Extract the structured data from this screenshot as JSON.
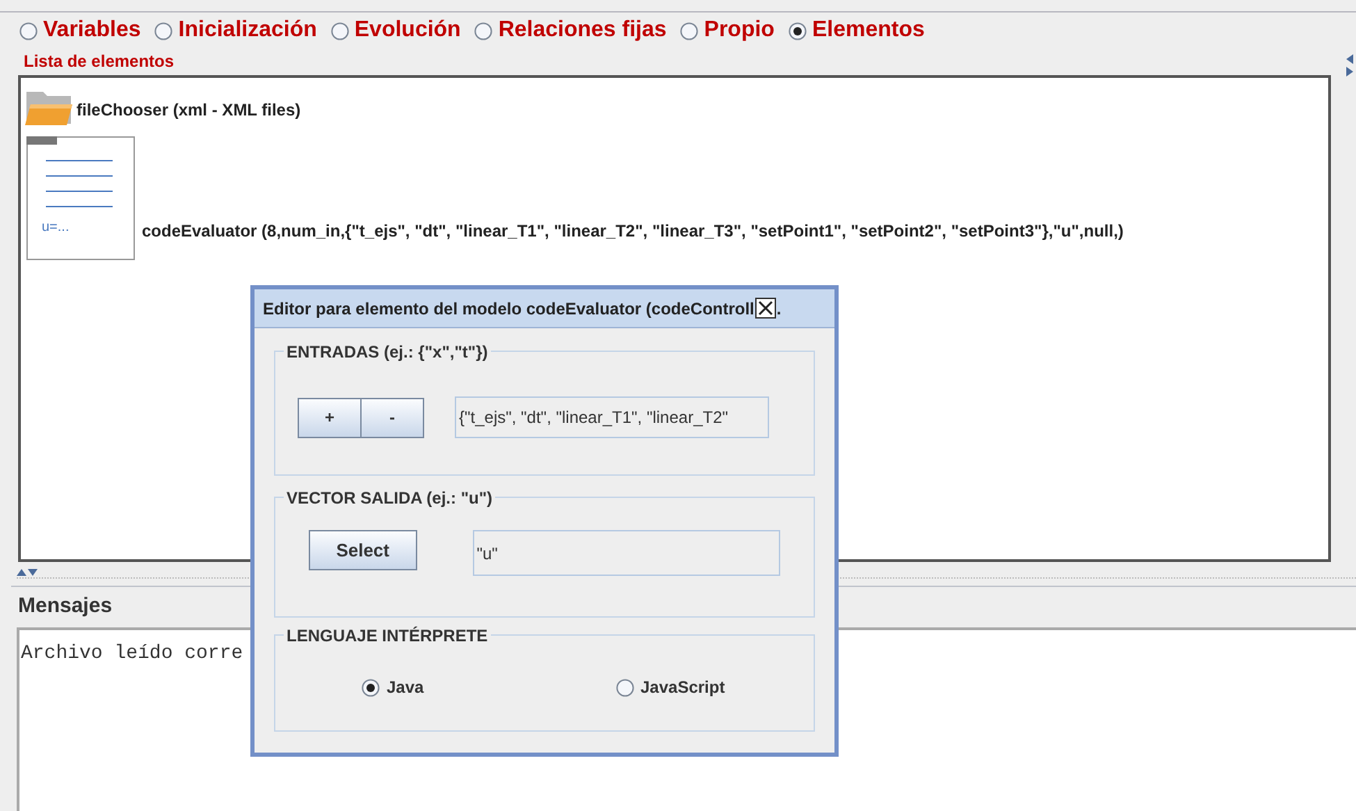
{
  "tabs": [
    {
      "label": "Variables",
      "selected": false
    },
    {
      "label": "Inicialización",
      "selected": false
    },
    {
      "label": "Evolución",
      "selected": false
    },
    {
      "label": "Relaciones fijas",
      "selected": false
    },
    {
      "label": "Propio",
      "selected": false
    },
    {
      "label": "Elementos",
      "selected": true
    }
  ],
  "element_list": {
    "title": "Lista de elementos",
    "items": [
      {
        "kind": "file",
        "label": "fileChooser (xml - XML files)"
      },
      {
        "kind": "code",
        "icon_text": "u=...",
        "label": "codeEvaluator (8,num_in,{\"t_ejs\", \"dt\", \"linear_T1\", \"linear_T2\", \"linear_T3\", \"setPoint1\", \"setPoint2\", \"setPoint3\"},\"u\",null,)"
      }
    ]
  },
  "messages": {
    "title": "Mensajes",
    "text": "Archivo leído corre"
  },
  "dialog": {
    "title": "Editor para elemento del modelo codeEvaluator (codeControll",
    "title_end": ".",
    "inputs": {
      "legend": "ENTRADAS (ej.: {\"x\",\"t\"})",
      "buttons": [
        "+",
        "-"
      ],
      "value": "{\"t_ejs\", \"dt\", \"linear_T1\", \"linear_T2\""
    },
    "output": {
      "legend": "VECTOR SALIDA (ej.: \"u\")",
      "button": "Select",
      "value": "\"u\""
    },
    "language": {
      "legend": "LENGUAJE INTÉRPRETE",
      "options": [
        {
          "label": "Java",
          "selected": true
        },
        {
          "label": "JavaScript",
          "selected": false
        }
      ]
    }
  }
}
